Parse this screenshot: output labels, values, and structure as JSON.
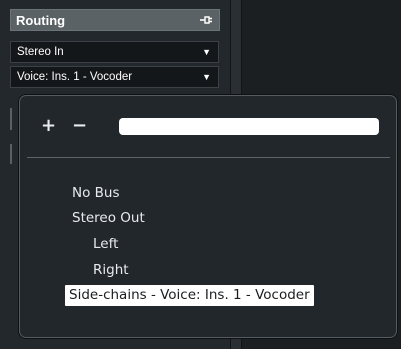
{
  "inspector": {
    "section_title": "Routing",
    "input_routing": "Stereo In",
    "output_routing": "Voice: Ins. 1 - Vocoder"
  },
  "popup": {
    "add_label": "+",
    "remove_label": "−",
    "search_value": "",
    "items": [
      {
        "label": "No Bus",
        "level": 0
      },
      {
        "label": "Stereo Out",
        "level": 0
      },
      {
        "label": "Left",
        "level": 1
      },
      {
        "label": "Right",
        "level": 1
      },
      {
        "label": "Side-chains - Voice: Ins. 1 - Vocoder",
        "level": 0,
        "selected": true
      }
    ]
  },
  "colors": {
    "header_bg": "#5b6266",
    "popup_bg": "#22272b",
    "selected_bg": "#ffffff",
    "selected_text": "#1a1d20"
  },
  "icons": {
    "routing": "routing-connector-icon",
    "dropdown": "chevron-down-icon"
  }
}
